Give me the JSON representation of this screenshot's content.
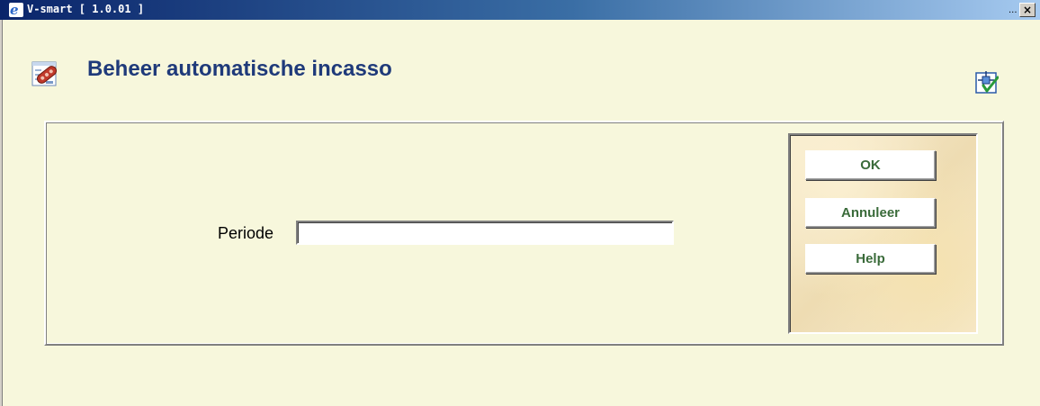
{
  "window": {
    "title": "V-smart [ 1.0.01 ]",
    "dots": "...",
    "close": "×"
  },
  "page": {
    "title": "Beheer automatische incasso"
  },
  "form": {
    "periode_label": "Periode",
    "periode_value": ""
  },
  "buttons": {
    "ok": "OK",
    "cancel": "Annuleer",
    "help": "Help"
  }
}
